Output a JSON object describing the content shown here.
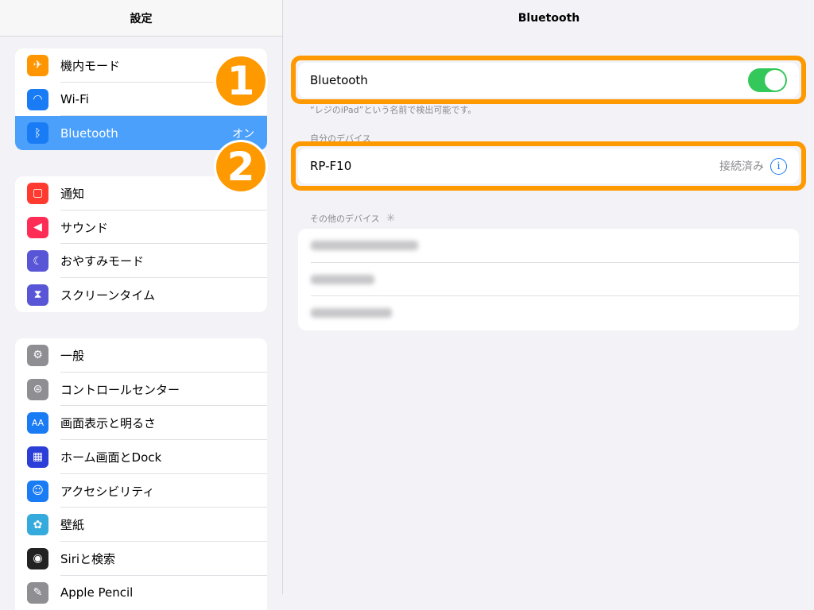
{
  "sidebar": {
    "title": "設定",
    "group1": [
      {
        "label": "機内モード",
        "icon": "airplane-icon",
        "color": "#ff9500"
      },
      {
        "label": "Wi-Fi",
        "icon": "wifi-icon",
        "color": "#1a7cf5"
      },
      {
        "label": "Bluetooth",
        "icon": "bluetooth-icon",
        "color": "#1a7cf5",
        "value": "オン",
        "selected": true
      }
    ],
    "group2": [
      {
        "label": "通知",
        "icon": "notification-icon",
        "color": "#ff3b30"
      },
      {
        "label": "サウンド",
        "icon": "sound-icon",
        "color": "#ff2d55"
      },
      {
        "label": "おやすみモード",
        "icon": "moon-icon",
        "color": "#5856d6"
      },
      {
        "label": "スクリーンタイム",
        "icon": "hourglass-icon",
        "color": "#5856d6"
      }
    ],
    "group3": [
      {
        "label": "一般",
        "icon": "gear-icon",
        "color": "#8e8e93"
      },
      {
        "label": "コントロールセンター",
        "icon": "switches-icon",
        "color": "#8e8e93"
      },
      {
        "label": "画面表示と明るさ",
        "icon": "text-size-icon",
        "color": "#1a7cf5"
      },
      {
        "label": "ホーム画面とDock",
        "icon": "grid-icon",
        "color": "#2c3ed8"
      },
      {
        "label": "アクセシビリティ",
        "icon": "accessibility-icon",
        "color": "#1a7cf5"
      },
      {
        "label": "壁紙",
        "icon": "flower-icon",
        "color": "#35aadc"
      },
      {
        "label": "Siriと検索",
        "icon": "siri-icon",
        "color": "#222"
      },
      {
        "label": "Apple Pencil",
        "icon": "pencil-icon",
        "color": "#8e8e93"
      }
    ]
  },
  "main": {
    "title": "Bluetooth",
    "toggle_label": "Bluetooth",
    "toggle_on": true,
    "discoverable_note": "“レジのiPad”という名前で検出可能です。",
    "my_devices_header": "自分のデバイス",
    "my_devices": [
      {
        "name": "RP-F10",
        "status": "接続済み"
      }
    ],
    "other_devices_header": "その他のデバイス"
  },
  "badges": [
    "1",
    "2"
  ],
  "colors": {
    "highlight": "#ff9900",
    "selected": "#4aa0fb",
    "toggle": "#34c759"
  }
}
